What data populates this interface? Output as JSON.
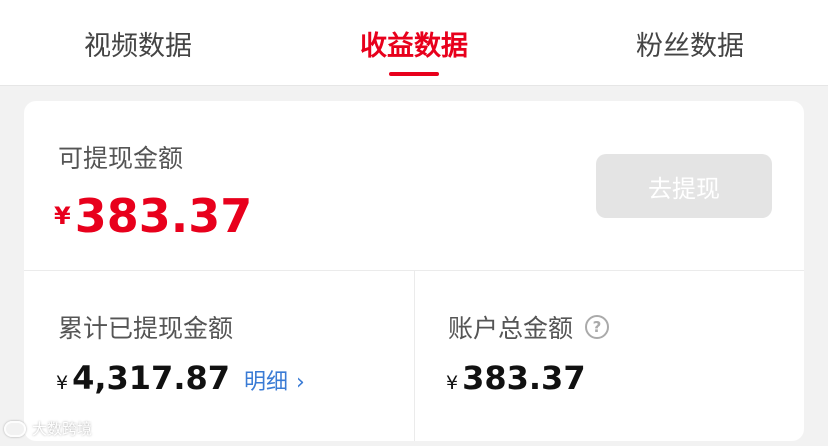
{
  "tabs": [
    {
      "label": "视频数据"
    },
    {
      "label": "收益数据"
    },
    {
      "label": "粉丝数据"
    }
  ],
  "active_tab_index": 1,
  "colors": {
    "accent": "#e8001c",
    "link": "#3a7bd5",
    "disabled_button": "#e4e4e4"
  },
  "withdrawable": {
    "label": "可提现金额",
    "currency": "¥",
    "amount": "383.37",
    "button_label": "去提现"
  },
  "total_withdrawn": {
    "label": "累计已提现金额",
    "currency": "¥",
    "amount": "4,317.87",
    "detail_label": "明细",
    "detail_icon": "chevron-right-icon"
  },
  "account_total": {
    "label": "账户总金额",
    "currency": "¥",
    "amount": "383.37",
    "help_icon": "question-circle-icon"
  },
  "watermark": {
    "text": "大数跨境"
  }
}
